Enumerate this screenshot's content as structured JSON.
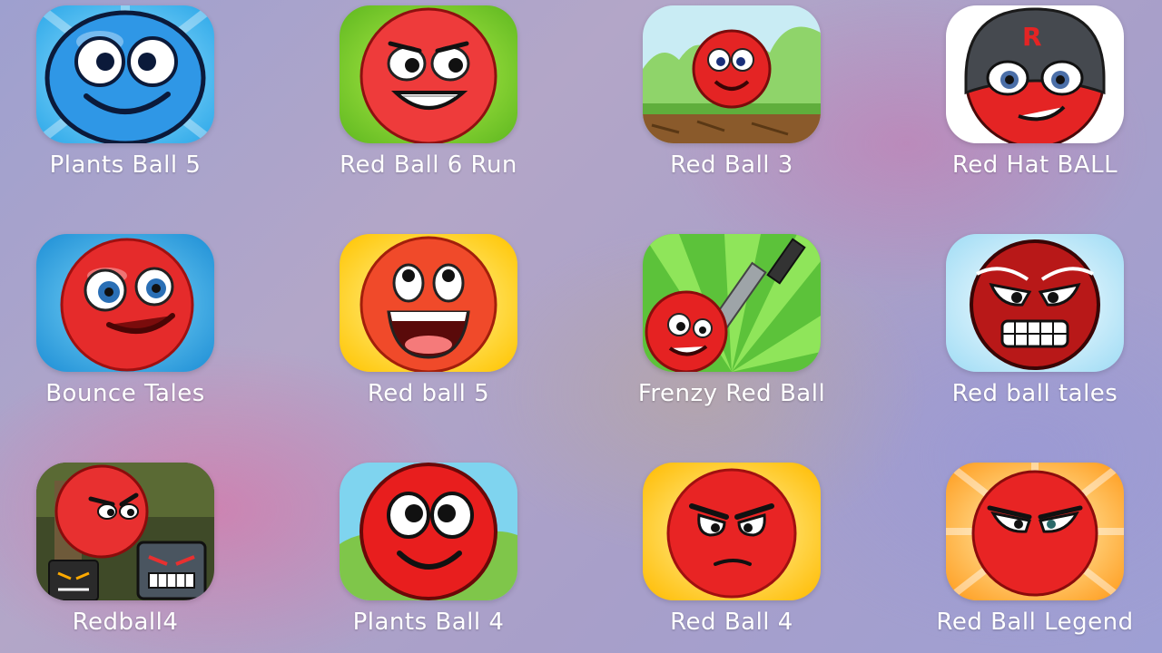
{
  "apps": [
    {
      "label": "Plants Ball 5",
      "icon": "blue-ball-smiling-icon"
    },
    {
      "label": "Red Ball 6 Run",
      "icon": "red-ball-grinning-icon"
    },
    {
      "label": "Red Ball 3",
      "icon": "red-ball-grass-icon"
    },
    {
      "label": "Red Hat BALL",
      "icon": "red-ball-masked-icon"
    },
    {
      "label": "Bounce Tales",
      "icon": "red-ball-blue-eyes-icon"
    },
    {
      "label": "Red ball 5",
      "icon": "red-ball-laughing-icon"
    },
    {
      "label": "Frenzy Red Ball",
      "icon": "red-ball-knife-icon"
    },
    {
      "label": "Red ball tales",
      "icon": "red-ball-angry-icon"
    },
    {
      "label": "Redball4",
      "icon": "red-ball-dark-squares-icon"
    },
    {
      "label": "Plants Ball 4",
      "icon": "red-ball-happy-icon"
    },
    {
      "label": "Red Ball 4",
      "icon": "red-ball-frown-icon"
    },
    {
      "label": "Red Ball Legend",
      "icon": "red-ball-sunburst-icon"
    }
  ]
}
